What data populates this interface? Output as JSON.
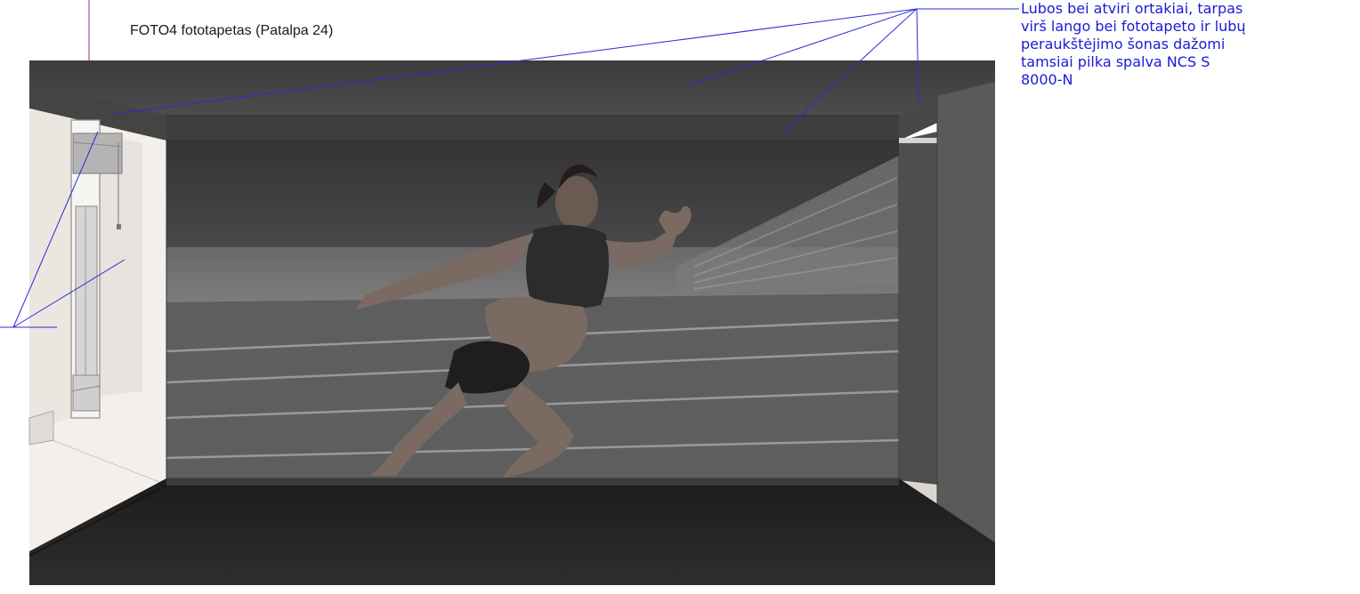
{
  "title": "FOTO4 fototapetas  (Patalpa 24)",
  "annotation": {
    "lines": [
      "Lubos bei atviri ortakiai, tarpas",
      "virš lango bei fototapeto ir lubų",
      "peraukštėjimo šonas dažomi",
      "tamsiai pilka spalva NCS S",
      "8000-N"
    ]
  },
  "colors": {
    "annotation": "#1a1ad6",
    "ceiling": "#4a4a4a",
    "floor": "#262626",
    "side_wall": "#f4efea",
    "dark_panel": "#555555"
  }
}
